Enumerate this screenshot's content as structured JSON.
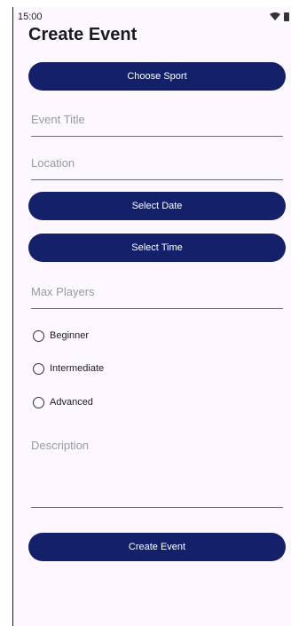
{
  "status_bar": {
    "time": "15:00",
    "wifi_icon": "wifi-icon",
    "battery_icon": "battery-icon"
  },
  "page": {
    "title": "Create Event"
  },
  "buttons": {
    "choose_sport": "Choose Sport",
    "select_date": "Select Date",
    "select_time": "Select Time",
    "create_event": "Create Event"
  },
  "fields": {
    "event_title": {
      "placeholder": "Event Title",
      "value": ""
    },
    "location": {
      "placeholder": "Location",
      "value": ""
    },
    "max_players": {
      "placeholder": "Max Players",
      "value": ""
    },
    "description": {
      "placeholder": "Description",
      "value": ""
    }
  },
  "skill_levels": [
    {
      "label": "Beginner",
      "selected": false
    },
    {
      "label": "Intermediate",
      "selected": false
    },
    {
      "label": "Advanced",
      "selected": false
    }
  ],
  "colors": {
    "primary": "#13216b",
    "background": "#fdf7ff"
  }
}
